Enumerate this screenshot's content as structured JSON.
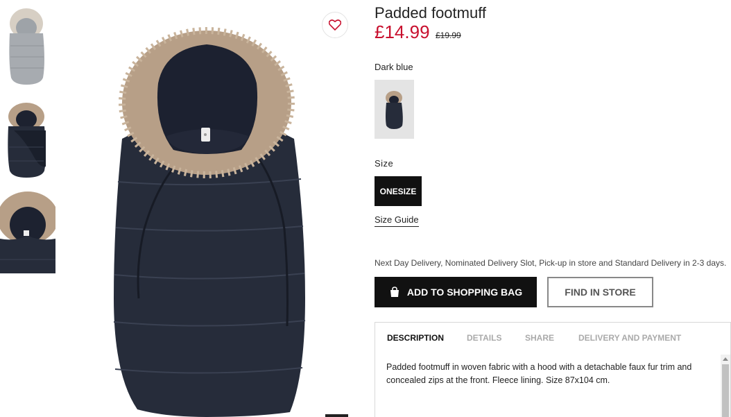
{
  "product": {
    "title": "Padded footmuff",
    "price": "£14.99",
    "old_price": "£19.99"
  },
  "color": {
    "label": "Dark blue"
  },
  "size": {
    "label": "Size",
    "selected": "ONESIZE",
    "guide_link": "Size Guide"
  },
  "delivery_text": "Next Day Delivery, Nominated Delivery Slot, Pick-up in store and Standard Delivery in 2-3 days.",
  "actions": {
    "add_to_bag": "ADD TO SHOPPING BAG",
    "find_in_store": "FIND IN STORE"
  },
  "tabs": [
    {
      "label": "DESCRIPTION"
    },
    {
      "label": "DETAILS"
    },
    {
      "label": "SHARE"
    },
    {
      "label": "DELIVERY AND PAYMENT"
    }
  ],
  "description": "Padded footmuff in woven fabric with a hood with a detachable faux fur trim and concealed zips at the front. Fleece lining. Size 87x104 cm.",
  "icons": {
    "wishlist": "heart-icon",
    "bag": "shopping-bag-icon"
  },
  "colors": {
    "price_red": "#c8102e",
    "product_navy": "#262c3a",
    "fur": "#b79f87"
  }
}
